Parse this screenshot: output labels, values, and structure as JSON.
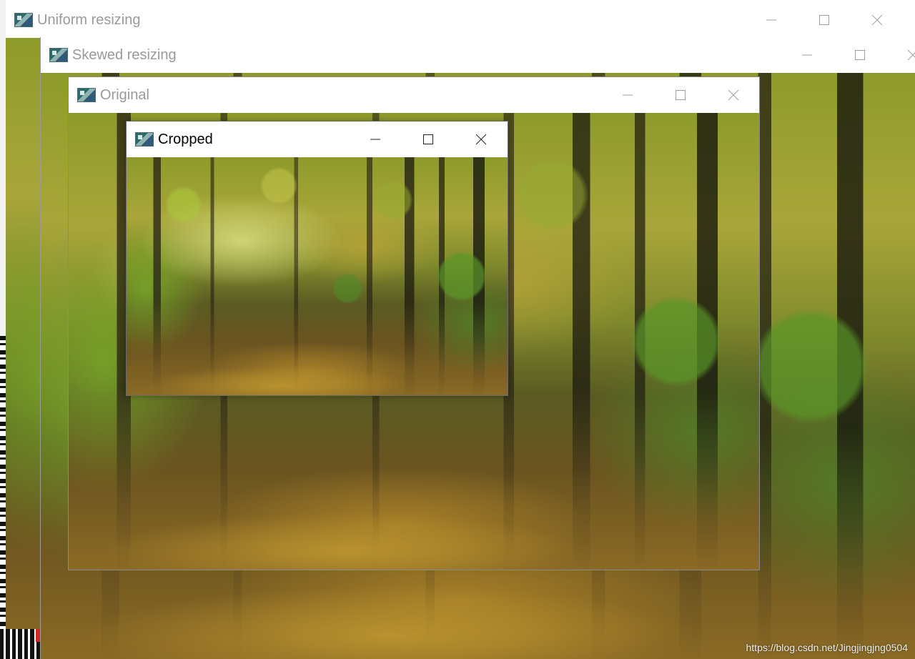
{
  "windows": {
    "uniform": {
      "title": "Uniform resizing"
    },
    "skewed": {
      "title": "Skewed resizing"
    },
    "original": {
      "title": "Original"
    },
    "cropped": {
      "title": "Cropped"
    }
  },
  "controls": {
    "minimize": "minimize-icon",
    "maximize": "maximize-icon",
    "close": "close-icon"
  },
  "watermark": "https://blog.csdn.net/Jingjingjng0504",
  "colors": {
    "title_active": "#000000",
    "title_inactive": "#9a9a9a",
    "titlebar_bg": "#ffffff"
  }
}
